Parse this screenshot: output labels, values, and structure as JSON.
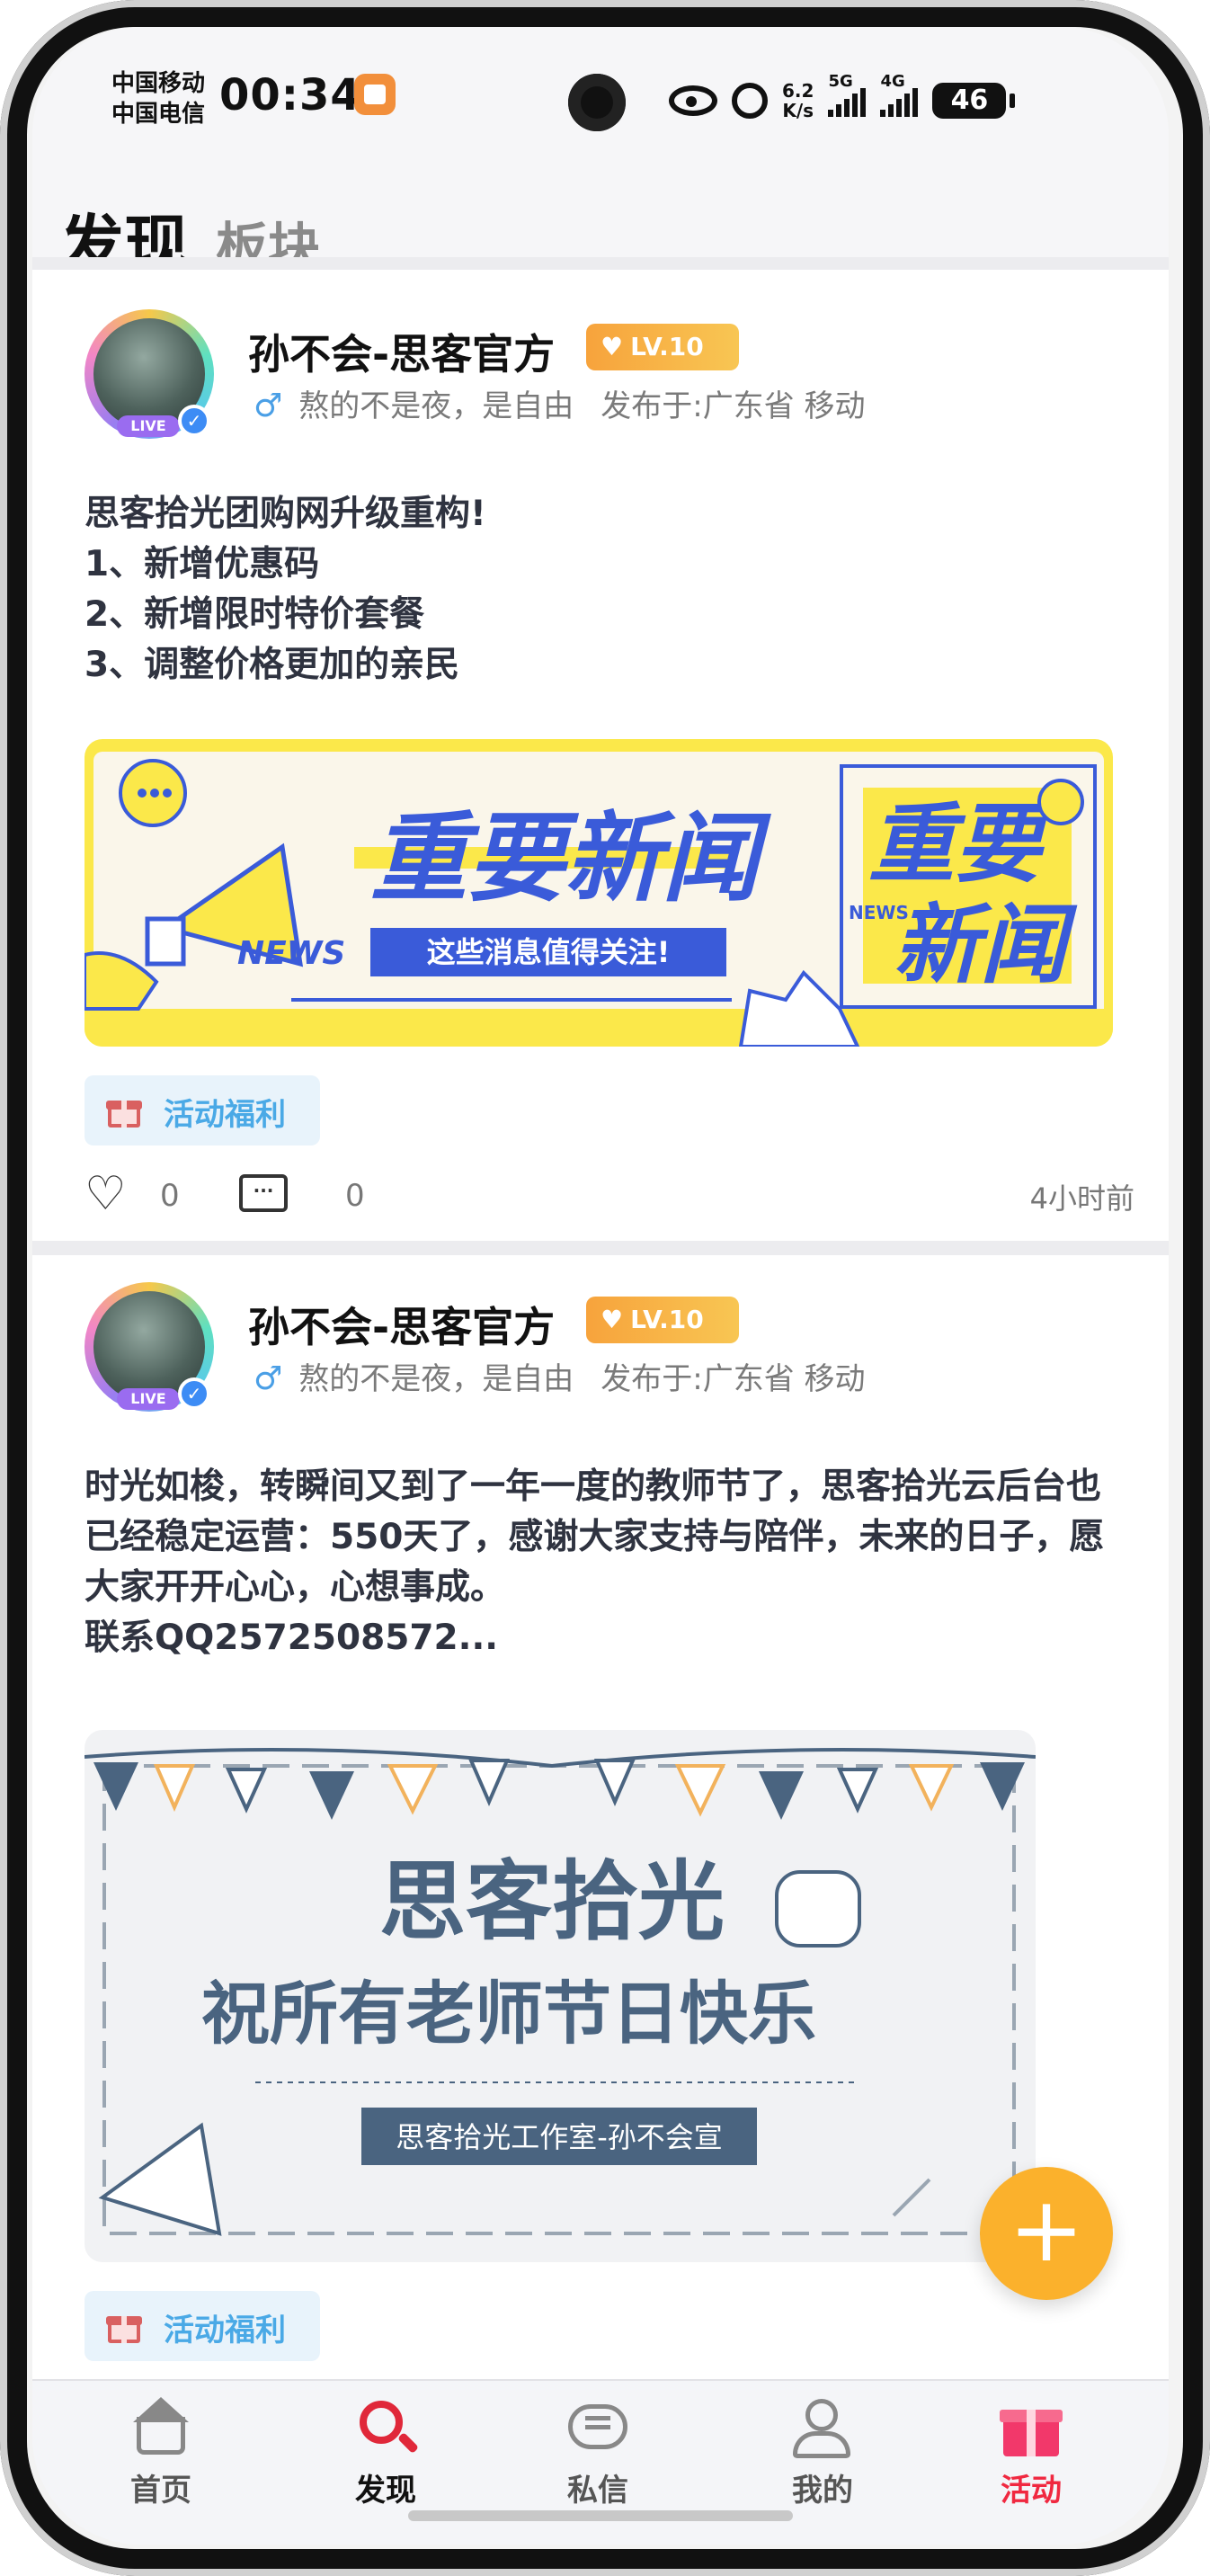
{
  "status_bar": {
    "carrier_1": "中国移动",
    "carrier_2": "中国电信",
    "time": "00:34",
    "net_speed_value": "6.2",
    "net_speed_unit": "K/s",
    "signal_1": "5G",
    "signal_2": "4G",
    "battery": "46"
  },
  "header": {
    "title": "发现",
    "subtitle": "板块"
  },
  "posts": [
    {
      "author": "孙不会-思客官方",
      "level": "LV.10",
      "live_badge": "LIVE",
      "gender_icon": "♂",
      "signature": "熬的不是夜，是自由",
      "location": "发布于:广东省 移动",
      "text": "思客拾光团购网升级重构!\n1、新增优惠码\n2、新增限时特价套餐\n3、调整价格更加的亲民",
      "banner": {
        "headline": "重要新闻",
        "subline": "这些消息值得关注!",
        "news_tag": "NEWS",
        "side_line_1": "重要",
        "side_line_2": "新闻"
      },
      "tag": "活动福利",
      "likes": "0",
      "comments": "0",
      "time_ago": "4小时前"
    },
    {
      "author": "孙不会-思客官方",
      "level": "LV.10",
      "live_badge": "LIVE",
      "gender_icon": "♂",
      "signature": "熬的不是夜，是自由",
      "location": "发布于:广东省 移动",
      "text": "时光如梭，转瞬间又到了一年一度的教师节了，思客拾光云后台也已经稳定运营：550天了，感谢大家支持与陪伴，未来的日子，愿大家开开心心，心想事成。\n联系QQ2572508572...",
      "banner": {
        "headline": "思客拾光",
        "subline": "祝所有老师节日快乐",
        "footer": "思客拾光工作室-孙不会宣"
      },
      "tag": "活动福利"
    }
  ],
  "fab_label": "+",
  "tabs": [
    {
      "label": "首页",
      "icon": "home-icon"
    },
    {
      "label": "发现",
      "icon": "search-icon"
    },
    {
      "label": "私信",
      "icon": "message-icon"
    },
    {
      "label": "我的",
      "icon": "user-icon"
    },
    {
      "label": "活动",
      "icon": "gift-icon"
    }
  ],
  "colors": {
    "accent_red": "#e0283a",
    "level_badge": "#f7a33c",
    "tag_blue": "#4aa9e6",
    "fab_orange": "#fbb12c",
    "news_blue": "#3a5bd9",
    "news_yellow": "#fbe84a",
    "teacher_slate": "#4a6480"
  }
}
